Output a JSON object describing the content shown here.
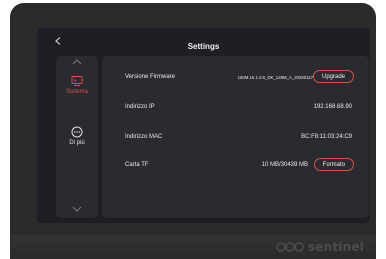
{
  "header": {
    "back_glyph": "‹",
    "title": "Settings"
  },
  "sidebar": {
    "items": [
      {
        "label": "Sistema",
        "icon": "system-icon",
        "active": true
      },
      {
        "label": "Di più",
        "icon": "more-icon",
        "active": false
      }
    ],
    "scroll_up_glyph": "︿",
    "scroll_down_glyph": "﹀"
  },
  "settings": {
    "firmware": {
      "label": "Versione Firmware",
      "value": "160M.16.1.0.6_DK_128M_A_20250117",
      "button": "Upgrade"
    },
    "ip": {
      "label": "Indirizzo IP",
      "value": "192.168.68.90"
    },
    "mac": {
      "label": "Indirizzo MAC",
      "value": "BC:F8:11:03:24:C9"
    },
    "sd": {
      "label": "Carta TF",
      "value": "10 MB/30439 MB",
      "button": "Formato"
    }
  },
  "brand": {
    "text": "sentinel"
  },
  "colors": {
    "accent": "#d6523f",
    "panel": "#2a2b30",
    "screen": "#1e1f24"
  }
}
